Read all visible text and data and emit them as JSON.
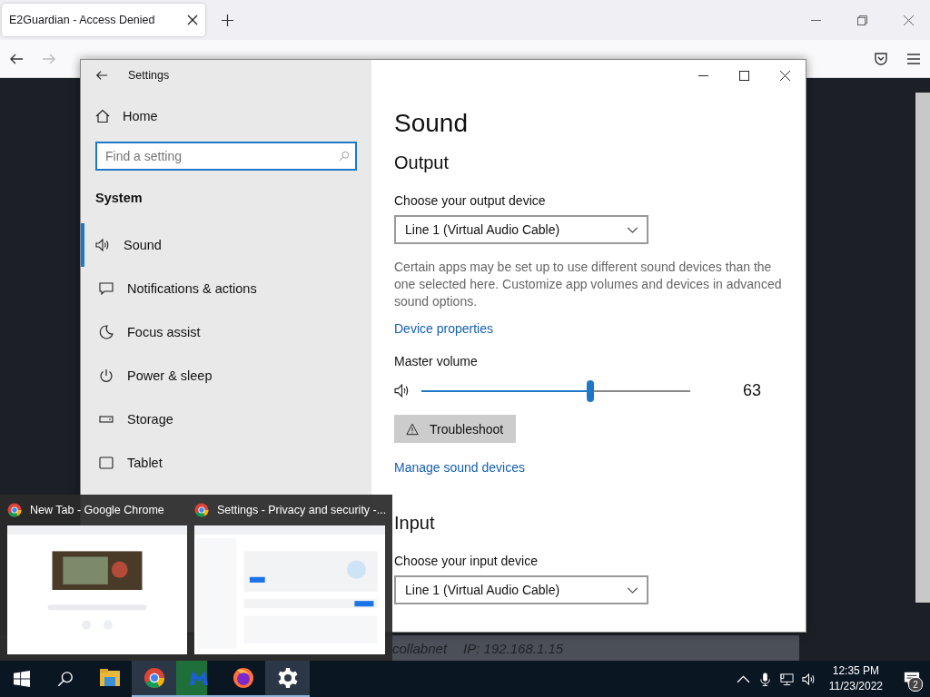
{
  "browser": {
    "tab_title": "E2Guardian - Access Denied",
    "page_footer": {
      "host": "collabnet",
      "ip": "IP: 192.168.1.15"
    }
  },
  "settings": {
    "title": "Settings",
    "home": "Home",
    "search": {
      "placeholder": "Find a setting"
    },
    "section": "System",
    "nav": [
      {
        "label": "Sound",
        "kind": "sound",
        "selected": true
      },
      {
        "label": "Notifications & actions",
        "kind": "notifications",
        "selected": false
      },
      {
        "label": "Focus assist",
        "kind": "moon",
        "selected": false
      },
      {
        "label": "Power & sleep",
        "kind": "power",
        "selected": false
      },
      {
        "label": "Storage",
        "kind": "storage",
        "selected": false
      },
      {
        "label": "Tablet",
        "kind": "tablet",
        "selected": false
      }
    ],
    "page_title": "Sound",
    "output": {
      "heading": "Output",
      "device_label": "Choose your output device",
      "device": "Line 1 (Virtual Audio Cable)",
      "description": "Certain apps may be set up to use different sound devices than the one selected here. Customize app volumes and devices in advanced sound options.",
      "link": "Device properties",
      "volume_label": "Master volume",
      "level": 0.63,
      "reading": "63",
      "troubleshoot": "Troubleshoot",
      "manage_link": "Manage sound devices"
    },
    "input": {
      "heading": "Input",
      "device_label": "Choose your input device",
      "device": "Line 1 (Virtual Audio Cable)"
    }
  },
  "thumbnails": [
    {
      "title": "New Tab - Google Chrome",
      "kind": "picture"
    },
    {
      "title": "Settings - Privacy and security -...",
      "kind": "picture"
    }
  ],
  "taskbar": {
    "apps": [
      {
        "kind": "explorer",
        "running": false,
        "selected": false
      },
      {
        "kind": "chrome",
        "running": true,
        "selected": true
      },
      {
        "kind": "malwarebytes",
        "running": true,
        "selected": false,
        "level": 0.7
      },
      {
        "kind": "firefox",
        "running": true,
        "selected": false
      },
      {
        "kind": "settings",
        "running": true,
        "selected": true
      }
    ],
    "time": "12:35 PM",
    "date": "11/23/2022",
    "notifications": "2"
  }
}
